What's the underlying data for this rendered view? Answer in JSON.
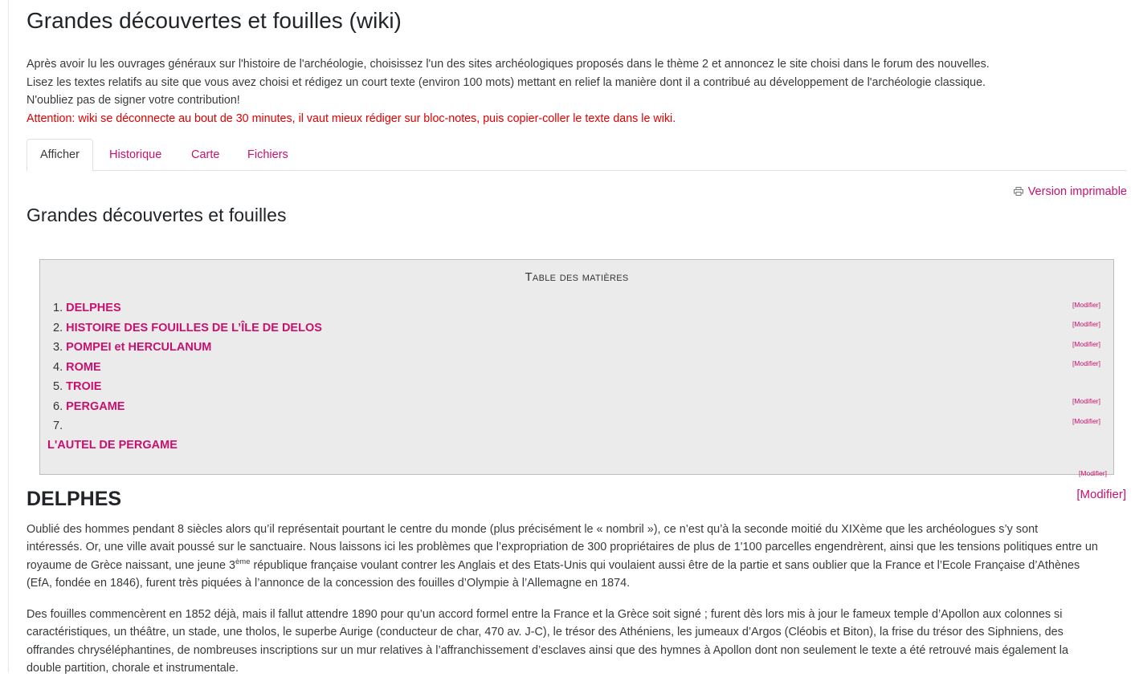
{
  "page": {
    "title": "Grandes découvertes et fouilles (wiki)",
    "intro_lines": [
      "Après avoir lu les ouvrages généraux sur l'histoire de l'archéologie, choisissez l'un des sites archéologiques proposés dans le thème 2 et annoncez le site choisi dans le forum des nouvelles.",
      "Lisez les textes relatifs au site que vous avez choisi et rédigez un court texte (environ 100 mots) mettant en relief la manière dont il a contribué au développement de l'archéologie classique.",
      "N'oubliez pas de signer votre contribution!"
    ],
    "warning": "Attention: wiki se déconnecte au bout de 30 minutes, il vaut mieux rédiger sur bloc-notes, puis copier-coller le texte dans le wiki."
  },
  "tabs": [
    {
      "label": "Afficher",
      "active": true
    },
    {
      "label": "Historique",
      "active": false
    },
    {
      "label": "Carte",
      "active": false
    },
    {
      "label": "Fichiers",
      "active": false
    }
  ],
  "print_link": {
    "label": "Version imprimable",
    "icon": "printer-icon"
  },
  "wiki": {
    "title": "Grandes découvertes et fouilles"
  },
  "toc": {
    "title": "Table des matières",
    "items": [
      {
        "num": "1.",
        "label": "DELPHES"
      },
      {
        "num": "2.",
        "label": "HISTOIRE DES FOUILLES DE L’ÎLE DE DELOS"
      },
      {
        "num": "3.",
        "label": "POMPEI et HERCULANUM"
      },
      {
        "num": "4.",
        "label": "ROME"
      },
      {
        "num": "5.",
        "label": "TROIE"
      },
      {
        "num": "6.",
        "label": "PERGAME"
      },
      {
        "num": "7.",
        "label": ""
      }
    ],
    "orphan_link": "L'AUTEL DE PERGAME",
    "modify_label": "[Modifier]"
  },
  "section": {
    "heading": "DELPHES",
    "modify_label": "[Modifier]",
    "para1": {
      "line1": "Oublié des hommes pendant 8 siècles alors qu’il représentait pourtant le centre du monde (plus précisément le « nombril »), ce n’est qu’à la seconde moitié du XIXème que les archéologues s’y sont",
      "line2": "intéressés. Or, une ville avait poussé sur le sanctuaire. Nous laissons ici les problèmes que l’expropriation de 300 propriétaires de plus de 1'100 parcelles engendrèrent, ainsi que les tensions politiques entre un",
      "line3_pre": "royaume de Grèce naissant, une jeune 3",
      "line3_sup": "ème",
      "line3_post": " république française voulant contrer les Anglais et des Etats-Unis qui voulaient aussi être de la partie et sans oublier que la France et  l’Ecole Française d’Athènes",
      "line4": "(EfA, fondée en 1846), furent très piquées à l’annonce de la concession des fouilles d’Olympie à l’Allemagne en 1874."
    },
    "para2": [
      "Des fouilles commencèrent en 1852 déjà, mais il fallut attendre 1890 pour qu’un accord formel entre la France et la Grèce soit signé ; furent dès lors mis à jour le fameux temple  d’Apollon aux colonnes si",
      "caractéristiques, un théâtre, un stade, une tholos, le superbe Aurige (conducteur de char, 470 av. J-C), le trésor des Athéniens, les jumeaux d’Argos (Cléobis et Biton), la frise du trésor des Siphniens, des",
      "offrandes chryséléphantines, de nombreuses inscriptions sur un mur relatives à l’affranchissement d’esclaves ainsi que des hymnes à Apollon dont non seulement le texte a été retrouvé mais également la",
      "double partition, chorale et instrumentale."
    ]
  },
  "colors": {
    "accent": "#c8116f",
    "warning": "#e00000",
    "toc_bg": "#ebebeb"
  }
}
